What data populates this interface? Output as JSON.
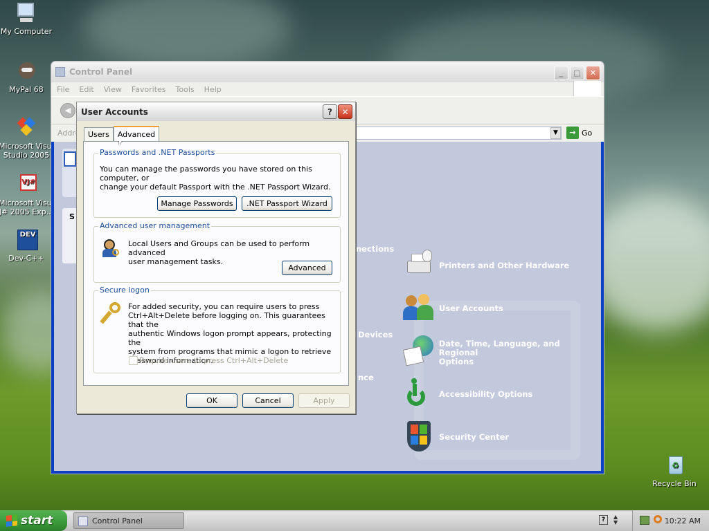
{
  "desktop": {
    "icons": [
      {
        "label1": "My Computer",
        "label2": ""
      },
      {
        "label1": "MyPal 68",
        "label2": ""
      },
      {
        "label1": "Microsoft Visual",
        "label2": "Studio 2005"
      },
      {
        "label1": "Microsoft Visual",
        "label2": "J# 2005 Exp..."
      },
      {
        "label1": "Dev-C++",
        "label2": ""
      },
      {
        "label1": "Recycle Bin",
        "label2": ""
      }
    ]
  },
  "control_panel": {
    "title": "Control Panel",
    "menu": [
      "File",
      "Edit",
      "View",
      "Favorites",
      "Tools",
      "Help"
    ],
    "address_label": "Addre",
    "go_label": "Go",
    "left_fragments": [
      "nections",
      "Devices",
      "nce"
    ],
    "categories": [
      {
        "label": "Printers and Other Hardware",
        "icon": "printer-icon"
      },
      {
        "label": "User Accounts",
        "icon": "users-icon"
      },
      {
        "label": "Date, Time, Language, and Regional",
        "label2": "Options",
        "icon": "globe-calendar-icon"
      },
      {
        "label": "Accessibility Options",
        "icon": "accessibility-icon"
      },
      {
        "label": "Security Center",
        "icon": "shield-icon"
      }
    ],
    "left_pane_letter": "S"
  },
  "dialog": {
    "title": "User Accounts",
    "help_glyph": "?",
    "close_glyph": "✕",
    "tabs": [
      "Users",
      "Advanced"
    ],
    "groups": {
      "passports": {
        "title": "Passwords and .NET Passports",
        "text1": "You can manage the passwords you have stored on this computer, or",
        "text2": "change your default Passport with the .NET Passport Wizard.",
        "btn_manage": "Manage Passwords",
        "btn_wizard": ".NET Passport Wizard"
      },
      "user_mgmt": {
        "title": "Advanced user management",
        "text1": "Local Users and Groups can be used to perform advanced",
        "text2": "user management tasks.",
        "btn_advanced": "Advanced"
      },
      "secure_logon": {
        "title": "Secure logon",
        "lines": [
          "For added security, you can require users to press",
          "Ctrl+Alt+Delete before logging on. This guarantees that the",
          "authentic Windows logon prompt appears, protecting the",
          "system from programs that mimic a logon to retrieve",
          "password information."
        ],
        "checkbox_label": "Require users to press Ctrl+Alt+Delete",
        "checkbox_checked": false
      }
    },
    "buttons": {
      "ok": "OK",
      "cancel": "Cancel",
      "apply": "Apply"
    }
  },
  "taskbar": {
    "start_label": "start",
    "task_label": "Control Panel",
    "clock": "10:22 AM"
  }
}
